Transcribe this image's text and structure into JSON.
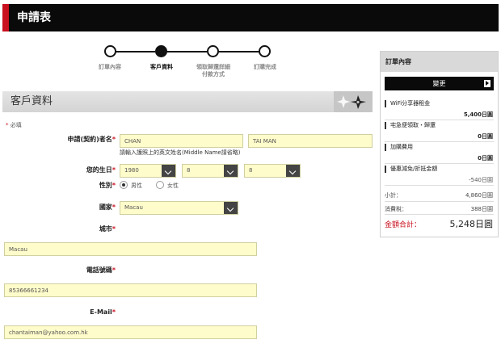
{
  "header": {
    "title": "申請表"
  },
  "stepper": {
    "steps": [
      {
        "label": "訂單內容",
        "active": false
      },
      {
        "label": "客戶資料",
        "active": true
      },
      {
        "label": "領取歸還詳細\n付款方式",
        "active": false
      },
      {
        "label": "訂購完成",
        "active": false
      }
    ]
  },
  "section": {
    "title": "客戶資料"
  },
  "form": {
    "required_note": "必填",
    "name_label": "申請(契約)者名",
    "last_name": "CHAN",
    "first_name": "TAI MAN",
    "name_hint": "請輸入護照上的英文姓名(Middle Name請省略)",
    "dob_label": "您的生日",
    "dob_year": "1980",
    "dob_month": "8",
    "dob_day": "8",
    "gender_label": "性別",
    "gender_male": "男性",
    "gender_female": "女性",
    "gender_selected": "male",
    "country_label": "國家",
    "country": "Macau",
    "city_label": "城市",
    "city": "Macau",
    "phone_label": "電話號碼",
    "phone": "85366661234",
    "email_label": "E-Mail",
    "email": "chantaiman@yahoo.com.hk",
    "required_mark": "*"
  },
  "order_panel": {
    "title": "訂單內容",
    "change_label": "變更",
    "items": [
      {
        "label": "WiFi分享器租金",
        "value": "5,400日圓"
      },
      {
        "label": "宅急便領取・歸還",
        "value": "0日圓"
      },
      {
        "label": "加購費用",
        "value": "0日圓"
      },
      {
        "label": "優惠減免/折抵金額",
        "value": "-540日圓"
      }
    ],
    "subtotal_label": "小計：",
    "subtotal_value": "4,860日圓",
    "tax_label": "消費稅：",
    "tax_value": "388日圓",
    "total_label": "金額合計：",
    "total_value": "5,248日圓"
  },
  "colors": {
    "accent_red": "#c8101e",
    "input_bg": "#fffccb",
    "header_bg": "#0a0a0a"
  }
}
